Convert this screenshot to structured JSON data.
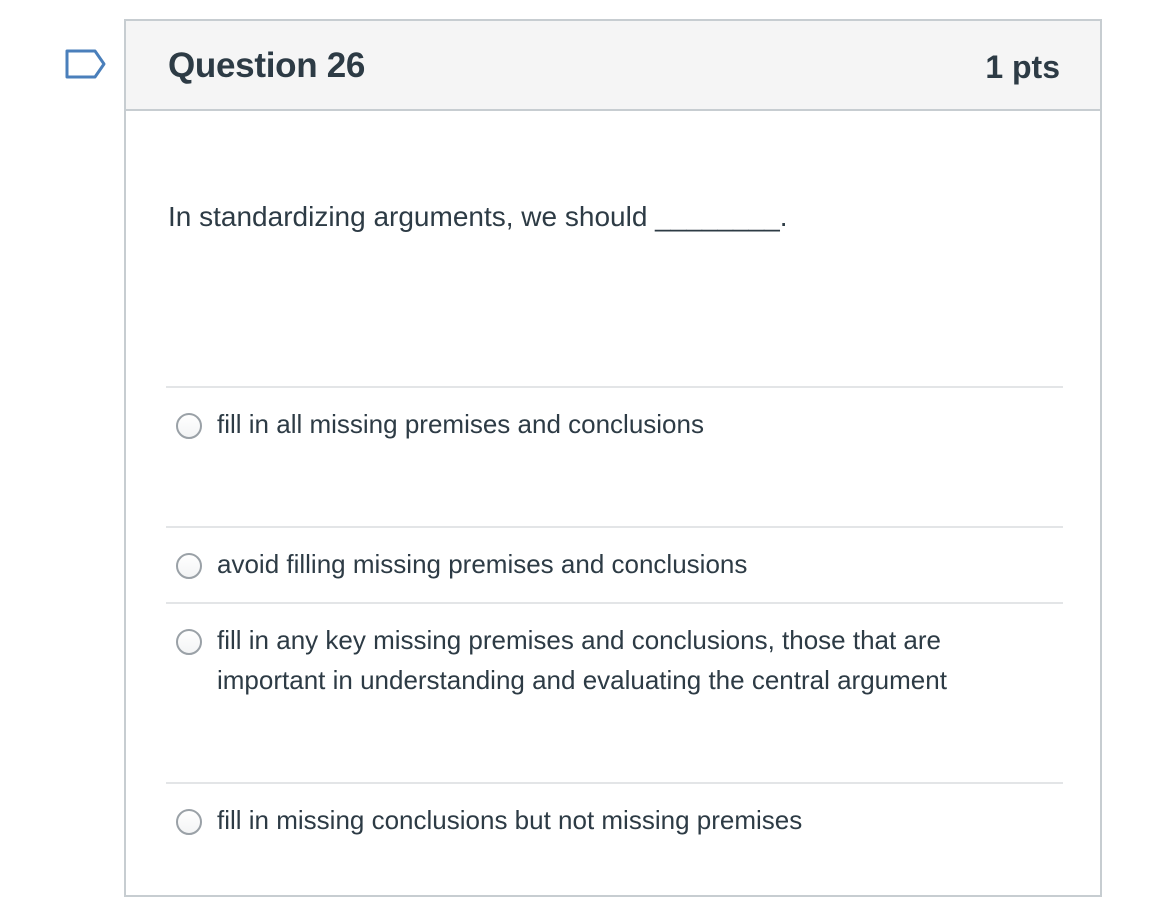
{
  "question": {
    "title": "Question 26",
    "points": "1 pts",
    "text": "In standardizing arguments, we should ________.",
    "flag_icon": "flag-question-icon",
    "colors": {
      "text": "#2d3b45",
      "header_bg": "#f5f5f5",
      "border": "#c7cdd1",
      "flag": "#4a7fbb"
    }
  },
  "answers": [
    {
      "label": "fill in all missing premises and conclusions",
      "selected": false
    },
    {
      "label": "avoid filling missing premises and conclusions",
      "selected": false
    },
    {
      "label": "fill in any key missing premises and conclusions, those that are important in understanding and evaluating the central argument",
      "selected": false
    },
    {
      "label": "fill in missing conclusions but not missing premises",
      "selected": false
    }
  ]
}
